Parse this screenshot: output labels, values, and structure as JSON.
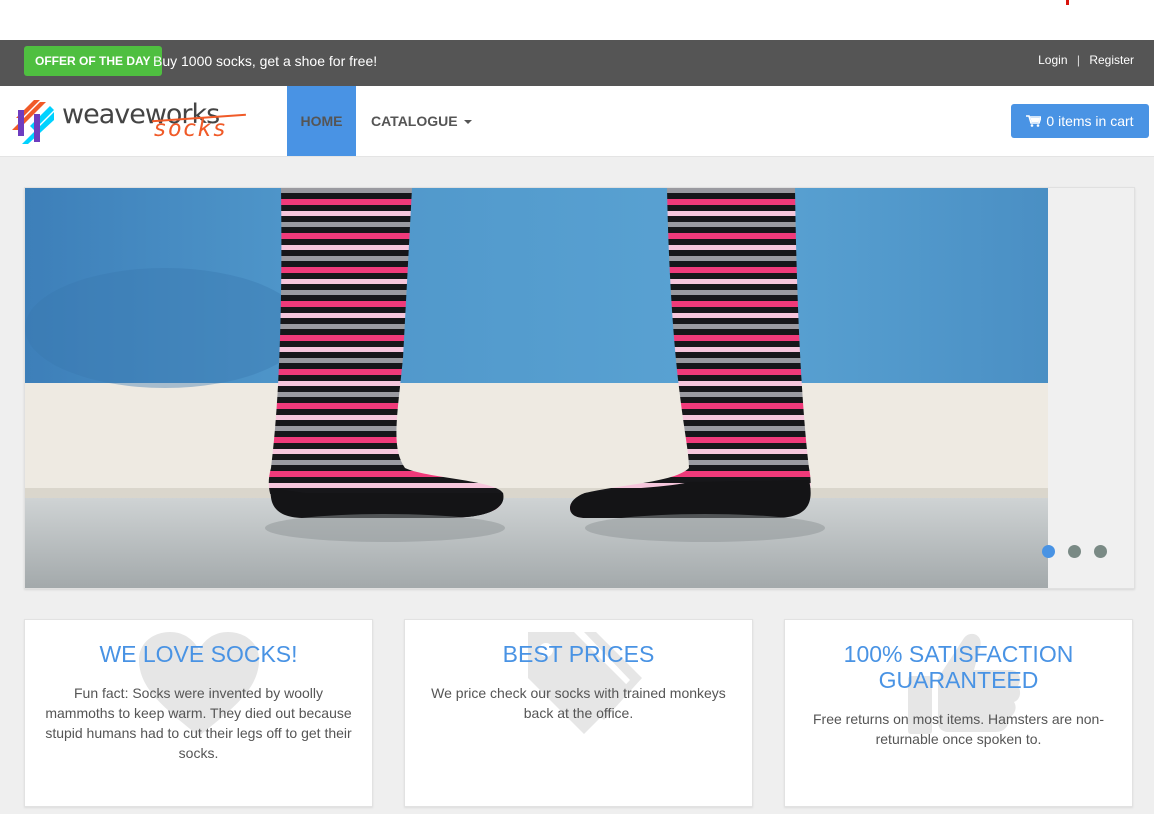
{
  "offer": {
    "badge": "OFFER OF THE DAY",
    "text": "Buy 1000 socks, get a shoe for free!"
  },
  "auth": {
    "login": "Login",
    "separator": "|",
    "register": "Register"
  },
  "brand": {
    "word": "weaveworks",
    "sub": "socks"
  },
  "nav": {
    "home": "HOME",
    "catalogue": "CATALOGUE",
    "cart": "0 items in cart"
  },
  "carousel": {
    "slide_count": 3,
    "active_index": 0
  },
  "features": [
    {
      "title": "WE LOVE SOCKS!",
      "text": "Fun fact: Socks were invented by woolly mammoths to keep warm. They died out because stupid humans had to cut their legs off to get their socks.",
      "icon": "heart-icon"
    },
    {
      "title": "BEST PRICES",
      "text": "We price check our socks with trained monkeys back at the office.",
      "icon": "tags-icon"
    },
    {
      "title": "100% SATISFACTION GUARANTEED",
      "text": "Free returns on most items. Hamsters are non-returnable once spoken to.",
      "icon": "thumbs-up-icon"
    }
  ],
  "colors": {
    "accent": "#4993e4",
    "offer_green": "#4fbf40",
    "brand_orange": "#f05a28",
    "dark_bar": "#555555"
  }
}
